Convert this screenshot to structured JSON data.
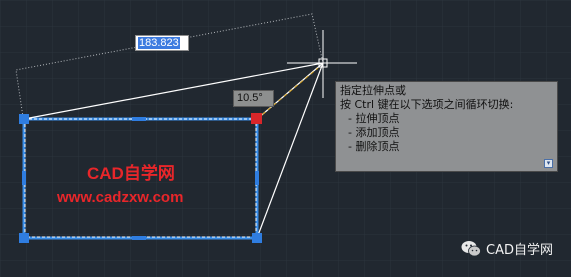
{
  "dimension_input": {
    "value": "183.823"
  },
  "angle_readout": "10.5°",
  "tooltip": {
    "title": "指定拉伸点或",
    "subtitle": "按 Ctrl 键在以下选项之间循环切换:",
    "options": [
      "- 拉伸顶点",
      "- 添加顶点",
      "- 删除顶点"
    ],
    "more_icon": "expand-arrow-icon"
  },
  "watermark": {
    "line1": "CAD自学网",
    "line2": "www.cadzxw.com"
  },
  "brand": {
    "label": "CAD自学网",
    "icon": "wechat-icon"
  },
  "colors": {
    "background": "#212830",
    "grid": "#2b333c",
    "selection": "#3a8de6",
    "grip": "#2f7de0",
    "hot_grip": "#d8262a",
    "crosshair": "#ffffff",
    "tracking": "#d6a21c",
    "watermark": "#e8262a"
  }
}
